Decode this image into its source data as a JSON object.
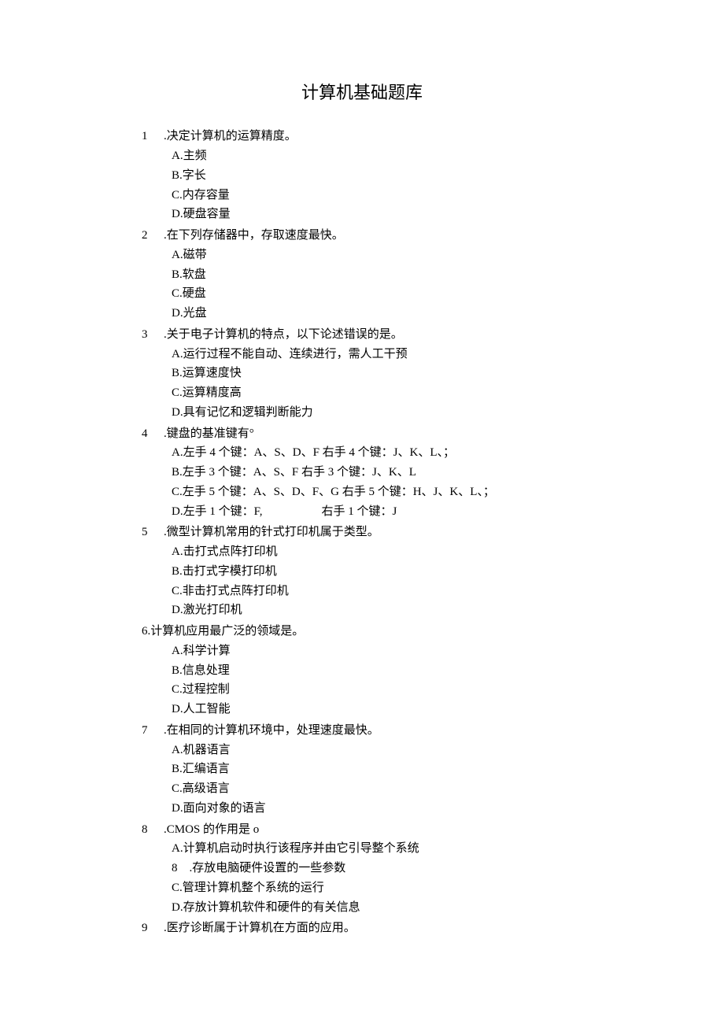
{
  "title": "计算机基础题库",
  "questions": [
    {
      "num": "1",
      "stem": ".决定计算机的运算精度。",
      "options": [
        "A.主频",
        "B.字长",
        "C.内存容量",
        "D.硬盘容量"
      ]
    },
    {
      "num": "2",
      "stem": ".在下列存储器中，存取速度最快。",
      "options": [
        "A.磁带",
        "B.软盘",
        "C.硬盘",
        "D.光盘"
      ]
    },
    {
      "num": "3",
      "stem": ".关于电子计算机的特点，以下论述错误的是。",
      "options": [
        "A.运行过程不能自动、连续进行，需人工干预",
        "B.运算速度快",
        "C.运算精度高",
        "D.具有记忆和逻辑判断能力"
      ]
    },
    {
      "num": "4",
      "stem": ".键盘的基准键有°",
      "options": [
        "A.左手 4 个键：A、S、D、F 右手 4 个键：J、K、L、；",
        "B.左手 3 个键：A、S、F 右手 3 个键：J、K、L",
        "C.左手 5 个键：A、S、D、F、G 右手 5 个键：H、J、K、L、；",
        "D.左手 1 个键：F,     右手 1 个键：J"
      ]
    },
    {
      "num": "5",
      "stem": ".微型计算机常用的针式打印机属于类型。",
      "options": [
        "A.击打式点阵打印机",
        "B.击打式字模打印机",
        "C.非击打式点阵打印机",
        "D.激光打印机"
      ]
    },
    {
      "num": "6.",
      "stem": "计算机应用最广泛的领域是。",
      "options": [
        "A.科学计算",
        "B.信息处理",
        "C.过程控制",
        "D.人工智能"
      ],
      "flat": true
    },
    {
      "num": "7",
      "stem": ".在相同的计算机环境中，处理速度最快。",
      "options": [
        "A.机器语言",
        "B.汇编语言",
        "C.高级语言",
        "D.面向对象的语言"
      ]
    },
    {
      "num": "8",
      "stem": ".CMOS 的作用是 o",
      "options": [
        "A.计算机启动时执行该程序并由它引导整个系统",
        "8 .存放电脑硬件设置的一些参数",
        "C.管理计算机整个系统的运行",
        "D.存放计算机软件和硬件的有关信息"
      ]
    },
    {
      "num": "9",
      "stem": ".医疗诊断属于计算机在方面的应用。",
      "options": []
    }
  ]
}
